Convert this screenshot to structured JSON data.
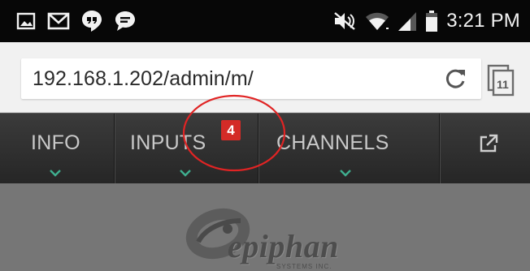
{
  "status_bar": {
    "time": "3:21 PM",
    "notification_icons": [
      "gallery-icon",
      "gmail-icon",
      "hangouts-icon",
      "messages-icon"
    ],
    "system_icons": [
      "nfc-mute-icon",
      "wifi-icon",
      "signal-icon",
      "battery-icon"
    ]
  },
  "browser": {
    "url": "192.168.1.202/admin/m/",
    "tab_count": "11"
  },
  "nav": {
    "items": [
      {
        "label": "INFO"
      },
      {
        "label": "INPUTS",
        "badge": "4"
      },
      {
        "label": "CHANNELS"
      }
    ],
    "external_link_icon": "external-link-icon"
  },
  "logo": {
    "word": "epiphan",
    "sub": "SYSTEMS INC."
  },
  "colors": {
    "statusbar_bg": "#070707",
    "nav_bg": "#2e2e2e",
    "badge_red": "#d42b27",
    "chevron_green": "#3fae8f",
    "content_bg": "#767676",
    "annotation_red": "#e02424"
  }
}
